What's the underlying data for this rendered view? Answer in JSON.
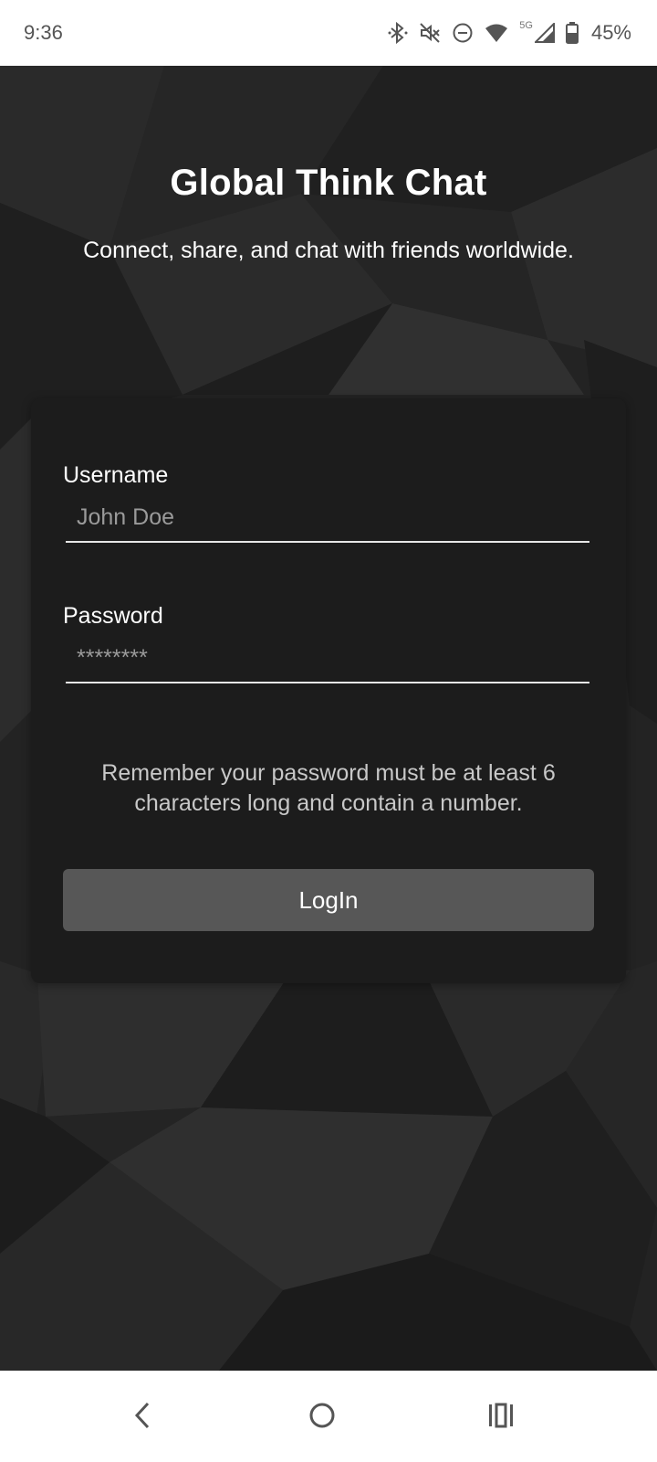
{
  "status_bar": {
    "time": "9:36",
    "network_type": "5G",
    "battery_percent": "45%",
    "icons": [
      "bluetooth-icon",
      "mute-icon",
      "do-not-disturb-icon",
      "wifi-icon",
      "cell-signal-icon",
      "battery-icon"
    ]
  },
  "app": {
    "title": "Global Think Chat",
    "subtitle": "Connect, share, and chat with friends worldwide."
  },
  "login_form": {
    "username_label": "Username",
    "username_placeholder": "John Doe",
    "password_label": "Password",
    "password_placeholder": "********",
    "hint": "Remember your password must be at least 6 characters long and contain a number.",
    "login_button": "LogIn"
  },
  "nav_bar": {
    "buttons": [
      "back-icon",
      "home-icon",
      "recents-icon"
    ]
  },
  "colors": {
    "background": "#232323",
    "card": "#1c1c1c",
    "button": "#575757",
    "text_primary": "#ffffff",
    "text_hint": "#c8c8c8"
  }
}
